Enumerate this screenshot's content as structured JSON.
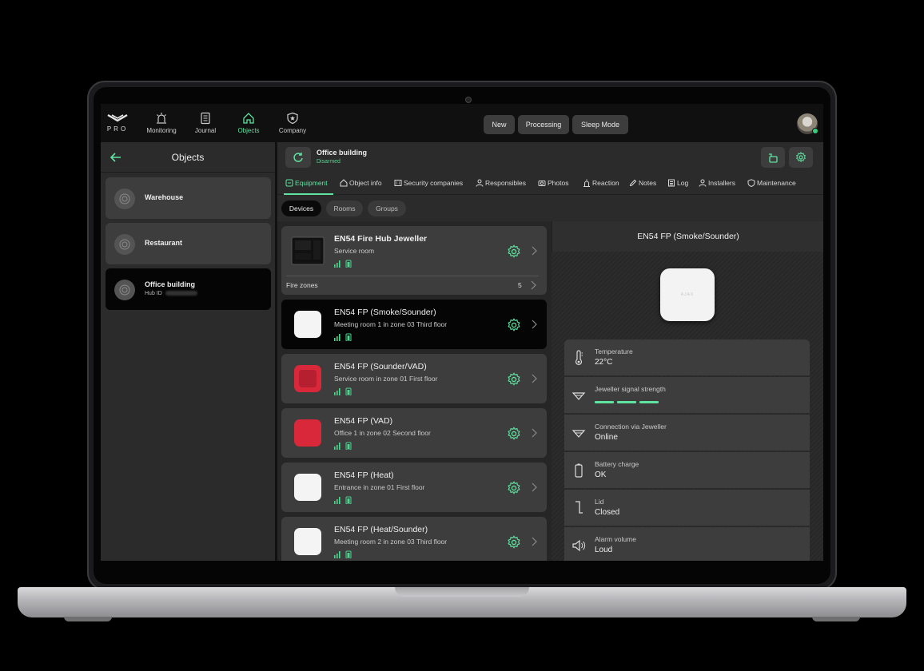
{
  "app": {
    "logo_text": "PRO",
    "nav": [
      {
        "label": "Monitoring",
        "icon": "alarm-siren-icon"
      },
      {
        "label": "Journal",
        "icon": "journal-icon"
      },
      {
        "label": "Objects",
        "icon": "home-icon",
        "active": true
      },
      {
        "label": "Company",
        "icon": "shield-star-icon"
      }
    ],
    "status_buttons": [
      "New",
      "Processing",
      "Sleep Mode"
    ]
  },
  "objects_panel": {
    "title": "Objects",
    "items": [
      {
        "name": "Warehouse"
      },
      {
        "name": "Restaurant"
      },
      {
        "name": "Office building",
        "sub": "Hub ID",
        "active": true
      }
    ]
  },
  "object": {
    "title": "Office building",
    "status": "Disarmed",
    "tabs": [
      "Equipment",
      "Object info",
      "Security companies",
      "Responsibles",
      "Photos",
      "Reaction",
      "Notes",
      "Log",
      "Installers",
      "Maintenance"
    ],
    "segments": [
      "Devices",
      "Rooms",
      "Groups"
    ],
    "devices": [
      {
        "name": "EN54 Fire Hub Jeweller",
        "room": "Service room",
        "type": "hub"
      },
      {
        "name": "EN54 FP (Smoke/Sounder)",
        "room": "Meeting room 1 in zone 03 Third floor",
        "type": "white",
        "selected": true
      },
      {
        "name": "EN54 FP (Sounder/VAD)",
        "room": "Service room in zone 01 First floor",
        "type": "red"
      },
      {
        "name": "EN54 FP (VAD)",
        "room": "Office 1 in zone 02 Second floor",
        "type": "red"
      },
      {
        "name": "EN54 FP (Heat)",
        "room": "Entrance in zone 01 First floor",
        "type": "white"
      },
      {
        "name": "EN54 FP (Heat/Sounder)",
        "room": "Meeting room 2 in zone 03 Third floor",
        "type": "white"
      }
    ],
    "fire_zones": {
      "label": "Fire zones",
      "count": "5"
    }
  },
  "detail": {
    "title": "EN54 FP (Smoke/Sounder)",
    "device_brand": "AJAX",
    "properties": [
      {
        "label": "Temperature",
        "value": "22°C",
        "icon": "thermometer-icon"
      },
      {
        "label": "Jeweller signal strength",
        "value": "",
        "icon": "signal-strength-icon",
        "signal_bars": 3
      },
      {
        "label": "Connection via Jeweller",
        "value": "Online",
        "icon": "jeweller-connection-icon"
      },
      {
        "label": "Battery charge",
        "value": "OK",
        "icon": "battery-icon"
      },
      {
        "label": "Lid",
        "value": "Closed",
        "icon": "lid-icon"
      },
      {
        "label": "Alarm volume",
        "value": "Loud",
        "icon": "speaker-icon"
      }
    ]
  },
  "colors": {
    "accent": "#5fe3a1",
    "panel": "#2b2b2b",
    "card": "#3d3d3d",
    "device_red": "#d8283a"
  }
}
